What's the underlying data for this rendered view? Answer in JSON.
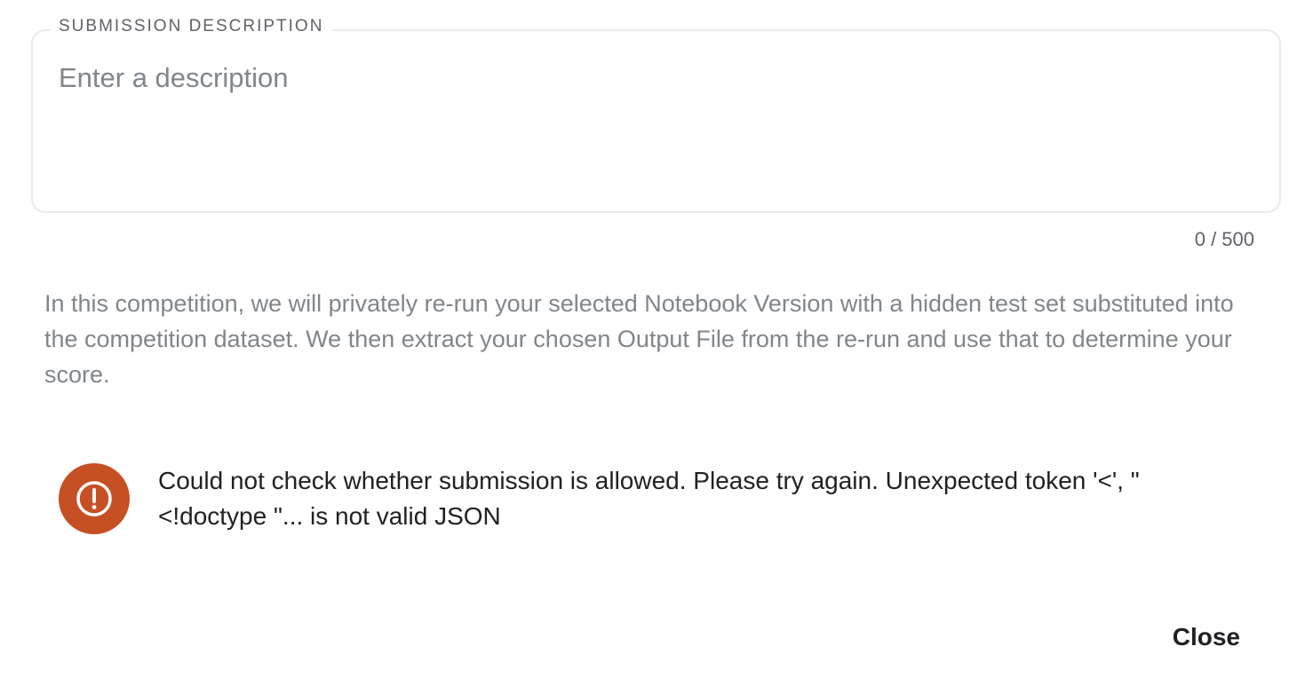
{
  "description_field": {
    "label": "SUBMISSION DESCRIPTION",
    "placeholder": "Enter a description",
    "value": "",
    "char_count": "0 / 500"
  },
  "info_text": "In this competition, we will privately re-run your selected Notebook Version with a hidden test set substituted into the competition dataset. We then extract your chosen Output File from the re-run and use that to determine your score.",
  "error_alert": {
    "icon": "alert-circle-icon",
    "icon_color": "#c65024",
    "message": "Could not check whether submission is allowed. Please try again. Unexpected token '<', \"<!doctype \"... is not valid JSON"
  },
  "actions": {
    "close_label": "Close"
  }
}
